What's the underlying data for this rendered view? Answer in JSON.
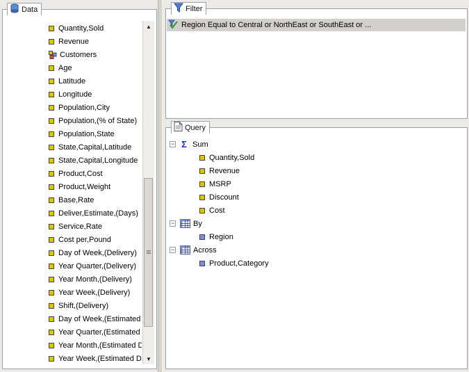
{
  "data_panel": {
    "title": "Data",
    "items": [
      {
        "label": "Quantity,Sold",
        "icon": "measure-icon"
      },
      {
        "label": "Revenue",
        "icon": "measure-icon"
      },
      {
        "label": "Customers",
        "icon": "customers-icon"
      },
      {
        "label": "Age",
        "icon": "measure-icon"
      },
      {
        "label": "Latitude",
        "icon": "measure-icon"
      },
      {
        "label": "Longitude",
        "icon": "measure-icon"
      },
      {
        "label": "Population,City",
        "icon": "measure-icon"
      },
      {
        "label": "Population,(% of State)",
        "icon": "measure-icon"
      },
      {
        "label": "Population,State",
        "icon": "measure-icon"
      },
      {
        "label": "State,Capital,Latitude",
        "icon": "measure-icon"
      },
      {
        "label": "State,Capital,Longitude",
        "icon": "measure-icon"
      },
      {
        "label": "Product,Cost",
        "icon": "measure-icon"
      },
      {
        "label": "Product,Weight",
        "icon": "measure-icon"
      },
      {
        "label": "Base,Rate",
        "icon": "measure-icon"
      },
      {
        "label": "Deliver,Estimate,(Days)",
        "icon": "measure-icon"
      },
      {
        "label": "Service,Rate",
        "icon": "measure-icon"
      },
      {
        "label": "Cost per,Pound",
        "icon": "measure-icon"
      },
      {
        "label": "Day of Week,(Delivery)",
        "icon": "measure-icon"
      },
      {
        "label": "Year Quarter,(Delivery)",
        "icon": "measure-icon"
      },
      {
        "label": "Year Month,(Delivery)",
        "icon": "measure-icon"
      },
      {
        "label": "Year Week,(Delivery)",
        "icon": "measure-icon"
      },
      {
        "label": "Shift,(Delivery)",
        "icon": "measure-icon"
      },
      {
        "label": "Day of Week,(Estimated",
        "icon": "measure-icon"
      },
      {
        "label": "Year Quarter,(Estimated",
        "icon": "measure-icon"
      },
      {
        "label": "Year Month,(Estimated D",
        "icon": "measure-icon"
      },
      {
        "label": "Year Week,(Estimated De",
        "icon": "measure-icon"
      }
    ]
  },
  "filter_panel": {
    "title": "Filter",
    "condition": "Region Equal to Central or NorthEast or SouthEast or ..."
  },
  "query_panel": {
    "title": "Query",
    "sum": {
      "label": "Sum",
      "fields": [
        "Quantity,Sold",
        "Revenue",
        "MSRP",
        "Discount",
        "Cost"
      ]
    },
    "by": {
      "label": "By",
      "fields": [
        "Region"
      ]
    },
    "across": {
      "label": "Across",
      "fields": [
        "Product,Category"
      ]
    }
  },
  "colors": {
    "measure": "#d8c800",
    "dimension": "#7f8fd0",
    "selection": "#d1d0ce",
    "sum_icon": "#1a2fb4"
  }
}
